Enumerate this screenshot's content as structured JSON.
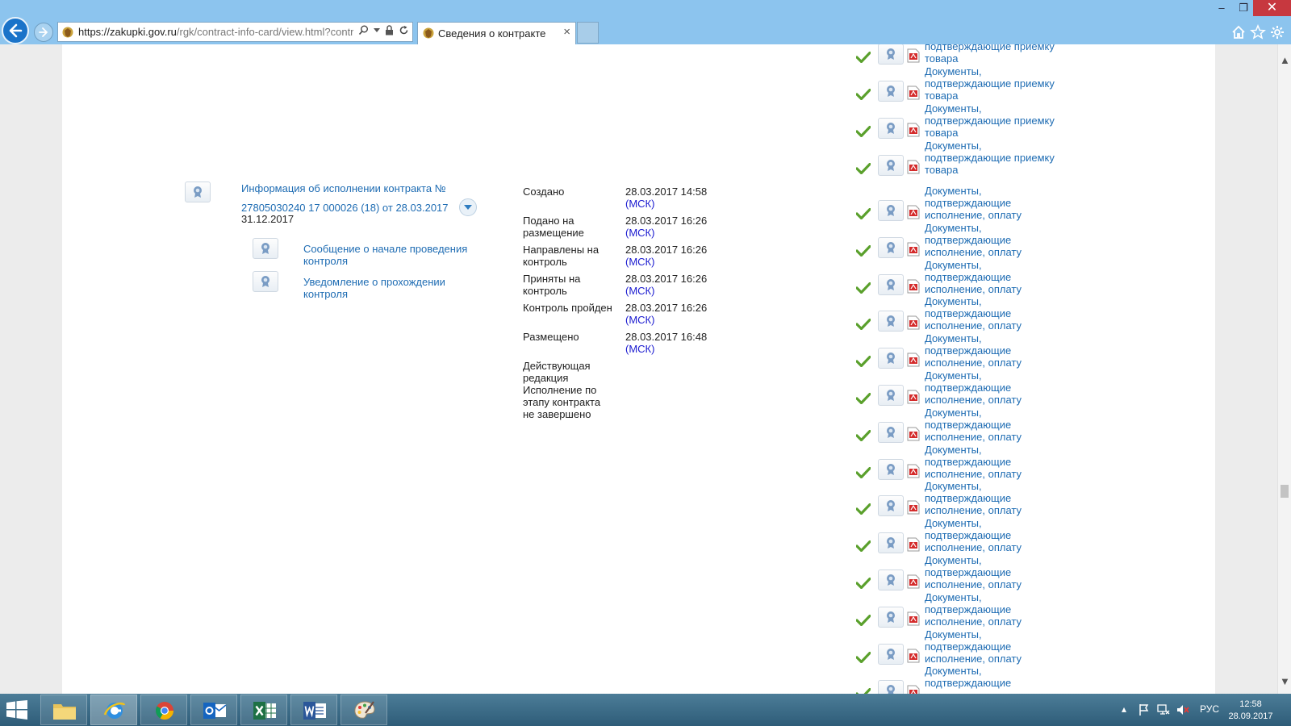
{
  "browser": {
    "url_host": "https://zakupki.gov.ru",
    "url_path": "/rgk/contract-info-card/view.html?contrac",
    "tab_title": "Сведения о контракте",
    "tab_close": "×"
  },
  "info": {
    "title": "Информация об исполнении контракта № 27805030240 17 000026 (18) от 28.03.2017",
    "date": "31.12.2017",
    "subdocs": [
      "Сообщение о начале проведения контроля",
      "Уведомление о прохождении контроля"
    ]
  },
  "statuses": [
    {
      "label": "Создано",
      "time": "28.03.2017 14:58",
      "tz": "(МСК)"
    },
    {
      "label": "Подано на размещение",
      "time": "28.03.2017 16:26",
      "tz": "(МСК)"
    },
    {
      "label": "Направлены на контроль",
      "time": "28.03.2017 16:26",
      "tz": "(МСК)"
    },
    {
      "label": "Приняты на контроль",
      "time": "28.03.2017 16:26",
      "tz": "(МСК)"
    },
    {
      "label": "Контроль пройден",
      "time": "28.03.2017 16:26",
      "tz": "(МСК)"
    },
    {
      "label": "Размещено",
      "time": "28.03.2017 16:48",
      "tz": "(МСК)"
    }
  ],
  "current_edition": "Действующая редакция",
  "stage_status": "Исполнение по этапу контракта не завершено",
  "documents": {
    "top_group": [
      "подтверждающие приемку товара",
      "Документы, подтверждающие приемку товара",
      "Документы, подтверждающие приемку товара",
      "Документы, подтверждающие приемку товара"
    ],
    "payment_group": [
      "Документы, подтверждающие исполнение, оплату",
      "Документы, подтверждающие исполнение, оплату",
      "Документы, подтверждающие исполнение, оплату",
      "Документы, подтверждающие исполнение, оплату",
      "Документы, подтверждающие исполнение, оплату",
      "Документы, подтверждающие исполнение, оплату",
      "Документы, подтверждающие исполнение, оплату",
      "Документы, подтверждающие исполнение, оплату",
      "Документы, подтверждающие исполнение, оплату",
      "Документы, подтверждающие исполнение, оплату",
      "Документы, подтверждающие исполнение, оплату",
      "Документы, подтверждающие исполнение, оплату",
      "Документы, подтверждающие исполнение, оплату",
      "Документы, подтверждающие"
    ]
  },
  "taskbar": {
    "language": "РУС",
    "time": "12:58",
    "date": "28.09.2017"
  },
  "colors": {
    "link": "#1e6cb3",
    "msk": "#1a1ad0",
    "check": "#5aa02c",
    "pdf": "#d42b2b",
    "titlebar": "#8cc4ee"
  }
}
